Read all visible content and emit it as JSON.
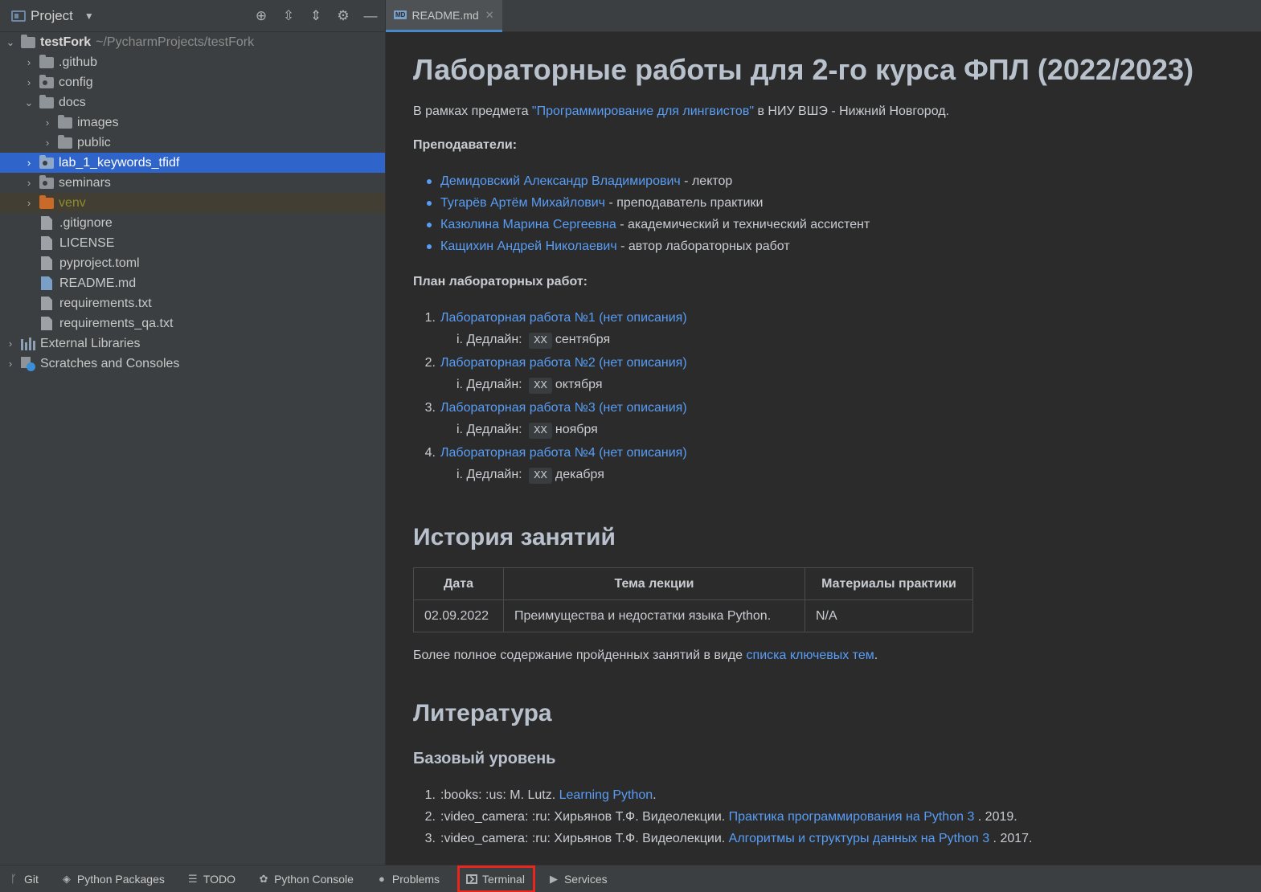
{
  "project_panel": {
    "title": "Project",
    "tree": {
      "root": {
        "name": "testFork",
        "path": "~/PycharmProjects/testFork"
      },
      "items": [
        {
          "label": ".github"
        },
        {
          "label": "config"
        },
        {
          "label": "docs"
        },
        {
          "label": "images"
        },
        {
          "label": "public"
        },
        {
          "label": "lab_1_keywords_tfidf"
        },
        {
          "label": "seminars"
        },
        {
          "label": "venv"
        },
        {
          "label": ".gitignore"
        },
        {
          "label": "LICENSE"
        },
        {
          "label": "pyproject.toml"
        },
        {
          "label": "README.md"
        },
        {
          "label": "requirements.txt"
        },
        {
          "label": "requirements_qa.txt"
        },
        {
          "label": "External Libraries"
        },
        {
          "label": "Scratches and Consoles"
        }
      ]
    }
  },
  "editor": {
    "tab": {
      "label": "README.md",
      "badge": "MD"
    },
    "readme": {
      "title": "Лабораторные работы для 2-го курса ФПЛ (2022/2023)",
      "intro": {
        "before": "В рамках предмета ",
        "link": "\"Программирование для лингвистов\"",
        "after": " в НИУ ВШЭ - Нижний Новгород."
      },
      "teachers_heading": "Преподаватели:",
      "teachers": [
        {
          "name": "Демидовский Александр Владимирович",
          "role": " - лектор"
        },
        {
          "name": "Тугарёв Артём Михайлович",
          "role": " - преподаватель практики"
        },
        {
          "name": "Казюлина Марина Сергеевна",
          "role": " - академический и технический ассистент"
        },
        {
          "name": "Кащихин Андрей Николаевич",
          "role": " - автор лабораторных работ"
        }
      ],
      "plan_heading": "План лабораторных работ:",
      "labs": [
        {
          "num": "1.",
          "title": "Лабораторная работа №1 (нет описания)",
          "deadline_prefix": "i. Дедлайн:",
          "deadline_code": "XX",
          "deadline_month": "сентября"
        },
        {
          "num": "2.",
          "title": "Лабораторная работа №2 (нет описания)",
          "deadline_prefix": "i. Дедлайн:",
          "deadline_code": "XX",
          "deadline_month": "октября"
        },
        {
          "num": "3.",
          "title": "Лабораторная работа №3 (нет описания)",
          "deadline_prefix": "i. Дедлайн:",
          "deadline_code": "XX",
          "deadline_month": "ноября"
        },
        {
          "num": "4.",
          "title": "Лабораторная работа №4 (нет описания)",
          "deadline_prefix": "i. Дедлайн:",
          "deadline_code": "XX",
          "deadline_month": "декабря"
        }
      ],
      "history_heading": "История занятий",
      "history_table": {
        "headers": [
          "Дата",
          "Тема лекции",
          "Материалы практики"
        ],
        "rows": [
          [
            "02.09.2022",
            "Преимущества и недостатки языка Python.",
            "N/A"
          ]
        ]
      },
      "history_note": {
        "before": "Более полное содержание пройденных занятий в виде ",
        "link": "списка ключевых тем",
        "after": "."
      },
      "literature_heading": "Литература",
      "basic_heading": "Базовый уровень",
      "literature": [
        {
          "num": "1.",
          "before": ":books: :us: M. Lutz. ",
          "link": "Learning Python",
          "after": "."
        },
        {
          "num": "2.",
          "before": ":video_camera: :ru: Хирьянов Т.Ф. Видеолекции. ",
          "link": "Практика программирования на Python 3",
          "after": " . 2019."
        },
        {
          "num": "3.",
          "before": ":video_camera: :ru: Хирьянов Т.Ф. Видеолекции. ",
          "link": "Алгоритмы и структуры данных на Python 3",
          "after": " . 2017."
        }
      ]
    }
  },
  "bottom_bar": {
    "items": [
      {
        "label": "Git",
        "icon": "git-branch-icon"
      },
      {
        "label": "Python Packages",
        "icon": "layers-icon"
      },
      {
        "label": "TODO",
        "icon": "list-icon"
      },
      {
        "label": "Python Console",
        "icon": "python-icon"
      },
      {
        "label": "Problems",
        "icon": "info-icon"
      },
      {
        "label": "Terminal",
        "icon": "terminal-icon"
      },
      {
        "label": "Services",
        "icon": "play-circle-icon"
      }
    ]
  },
  "colors": {
    "panel_bg": "#3c3f41",
    "editor_bg": "#2b2b2b",
    "selection": "#2f65ca",
    "link": "#589df6",
    "highlight_box": "#e8261c"
  }
}
